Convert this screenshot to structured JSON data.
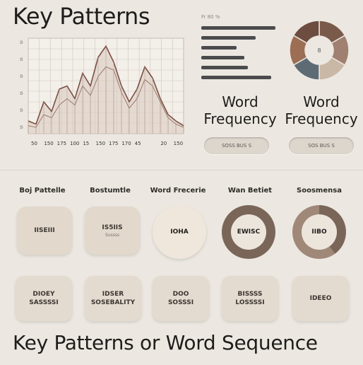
{
  "header": {
    "title": "Key Patterns"
  },
  "footer": {
    "title": "Key Patterns or Word Sequence"
  },
  "chart_data": {
    "type": "line",
    "x": [
      0,
      1,
      2,
      3,
      4,
      5,
      6,
      7,
      8,
      9,
      10,
      11,
      12,
      13,
      14,
      15,
      16,
      17,
      18,
      19,
      20
    ],
    "series": [
      {
        "values": [
          8,
          6,
          20,
          14,
          28,
          30,
          22,
          38,
          30,
          48,
          55,
          45,
          30,
          20,
          28,
          42,
          35,
          22,
          12,
          8,
          5
        ]
      },
      {
        "values": [
          5,
          4,
          12,
          10,
          18,
          22,
          18,
          30,
          24,
          36,
          42,
          40,
          26,
          16,
          22,
          34,
          30,
          20,
          10,
          6,
          4
        ]
      }
    ],
    "xtick_labels": [
      "50",
      "150",
      "175",
      "100",
      "15",
      "150",
      "175",
      "170",
      "45",
      " ",
      "20",
      "150"
    ],
    "ylim": [
      0,
      60
    ],
    "grid": true
  },
  "legend": {
    "caption": "Fr 80 %",
    "bars": [
      0.95,
      0.7,
      0.45,
      0.55,
      0.6,
      0.9
    ]
  },
  "donut": {
    "center": "8",
    "slices": [
      {
        "value": 1,
        "color": "#7a5a4a"
      },
      {
        "value": 1,
        "color": "#a08070"
      },
      {
        "value": 1,
        "color": "#c9b8a6"
      },
      {
        "value": 1,
        "color": "#5e6b74"
      },
      {
        "value": 1,
        "color": "#9c6e54"
      },
      {
        "value": 1,
        "color": "#6d4d40"
      }
    ]
  },
  "word_freq_left": "Word\nFrequency",
  "word_freq_right": "Word\nFrequency",
  "pill_left": "SOSS BUS S",
  "pill_right": "SOS BUS S",
  "columns": [
    "Boj Pattelle",
    "Bostumtle",
    "Word Frecerie",
    "Wan Betiet",
    "Soosmensa"
  ],
  "tiles_row1": [
    {
      "main": "IISEIII",
      "sub": ""
    },
    {
      "main": "IS5IIS",
      "sub": "Sussss"
    },
    {
      "main": "IOHA",
      "sub": ""
    },
    {
      "main": "EWISC",
      "sub": ""
    },
    {
      "main": "IIBO",
      "sub": ""
    }
  ],
  "tiles_row2": [
    {
      "main": "DIOEY\nSASSSSI"
    },
    {
      "main": "IDSER\nSOSEBALITY"
    },
    {
      "main": "DOO\nSOSSSI"
    },
    {
      "main": "BISSSS\nLOSSSSI"
    },
    {
      "main": "IDEEO"
    }
  ],
  "colors": {
    "ring": "#7a6658",
    "ring2": "#a08878",
    "bg": "#ece8e1"
  }
}
